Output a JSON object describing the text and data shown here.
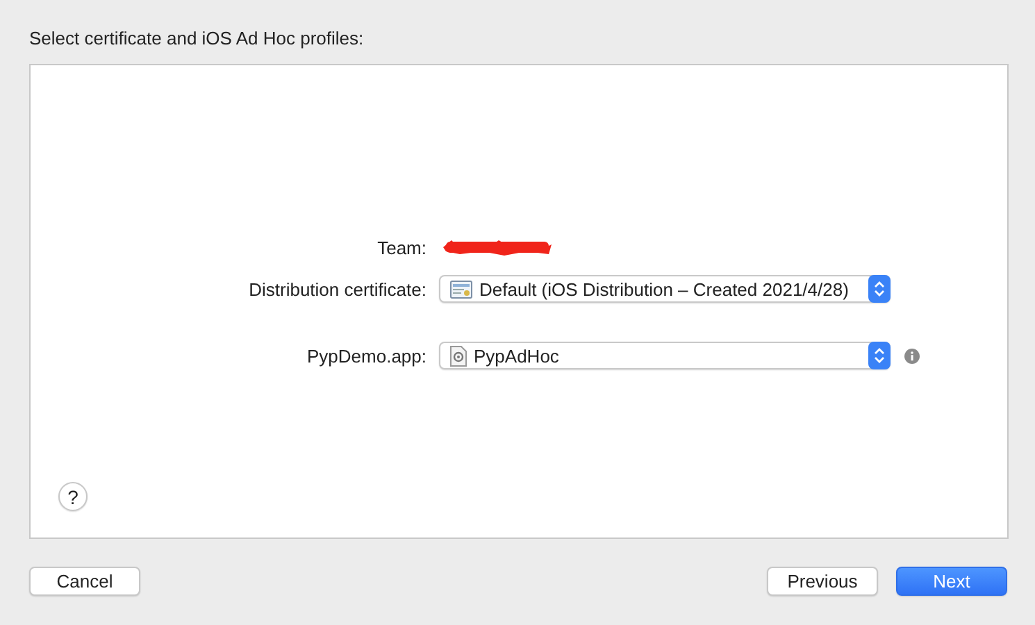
{
  "heading": "Select certificate and iOS Ad Hoc profiles:",
  "fields": [
    {
      "label": "Team:",
      "kind": "redacted"
    },
    {
      "label": "Distribution certificate:",
      "kind": "certificate-popup",
      "value": "Default (iOS Distribution – Created 2021/4/28)"
    },
    {
      "label": "PypDemo.app:",
      "kind": "profile-popup",
      "value": "PypAdHoc",
      "info": true
    }
  ],
  "help": "?",
  "buttons": [
    {
      "label": "Cancel",
      "kind": "default"
    },
    {
      "label": "Previous",
      "kind": "default"
    },
    {
      "label": "Next",
      "kind": "primary"
    }
  ]
}
